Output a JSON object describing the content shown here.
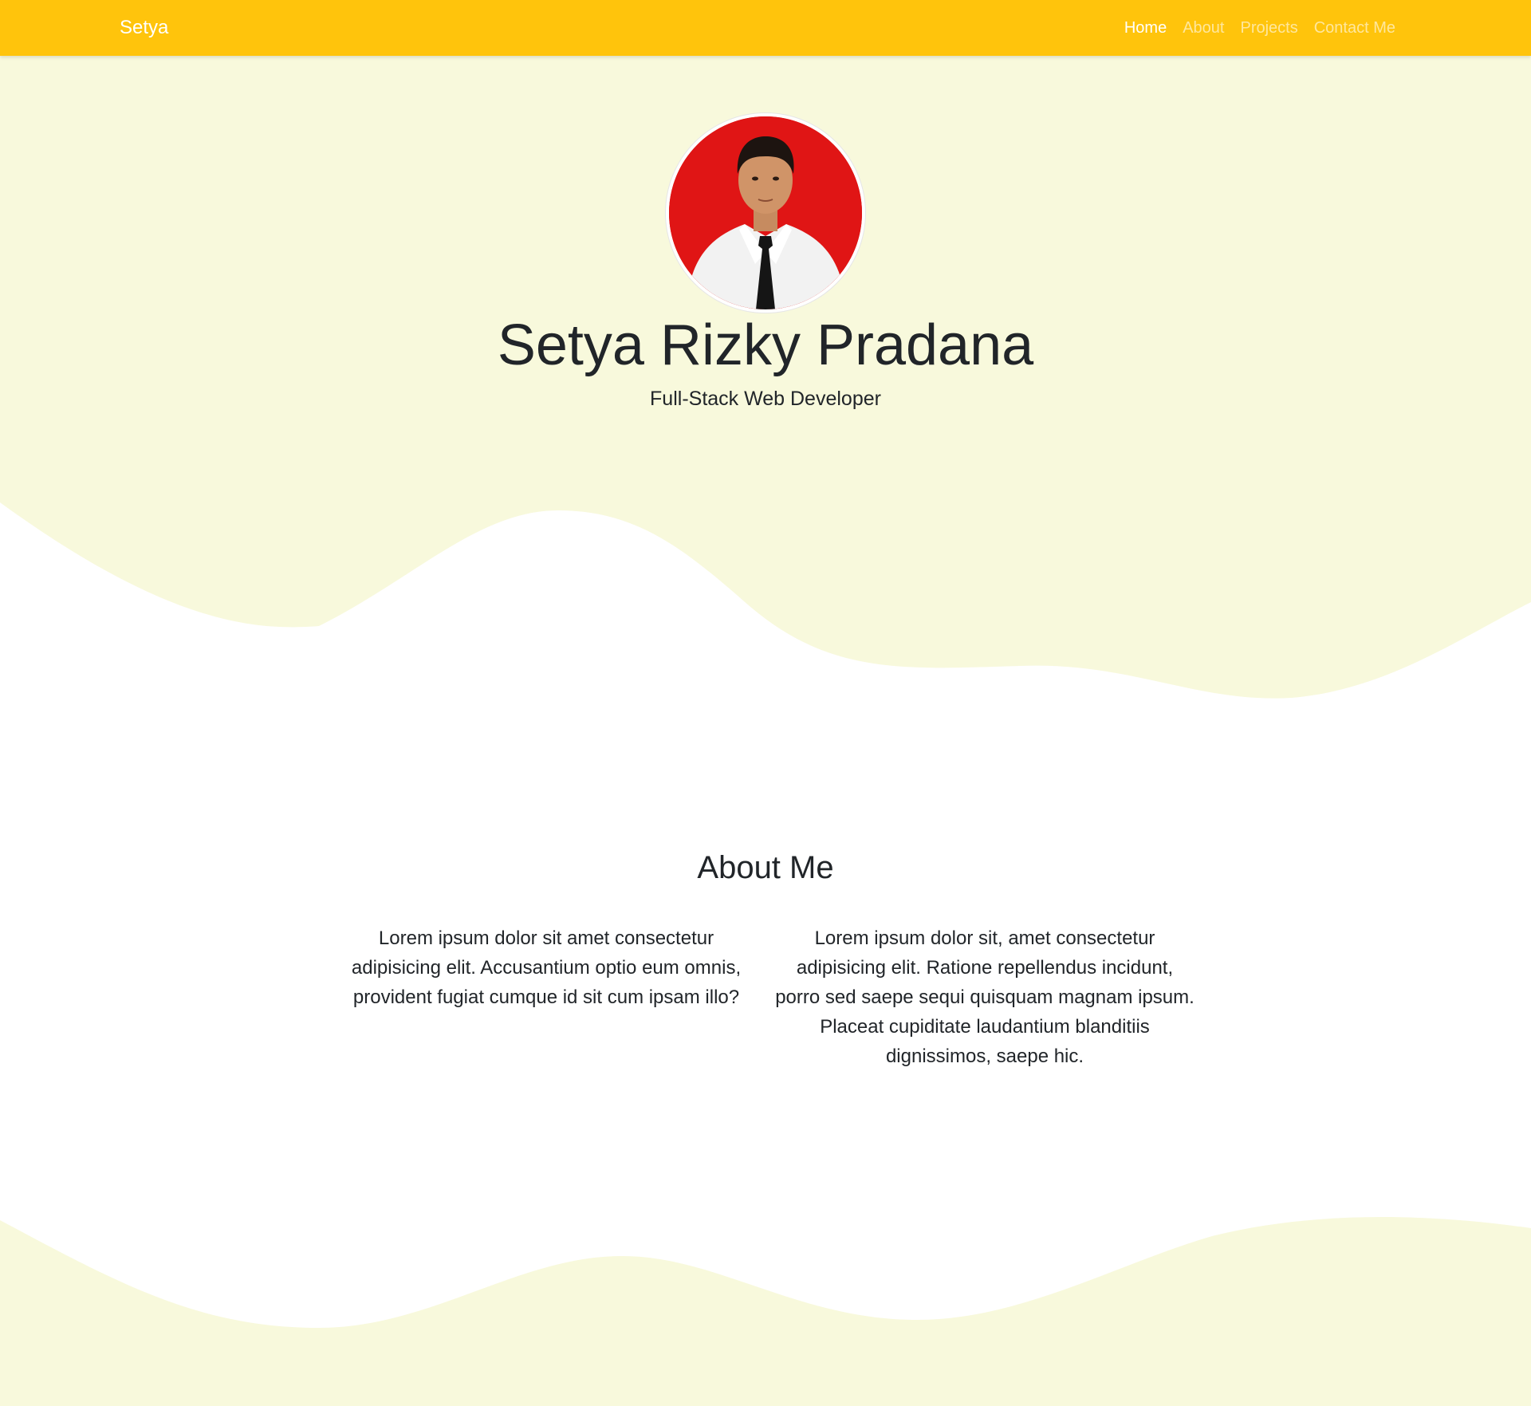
{
  "navbar": {
    "brand": "Setya",
    "links": [
      {
        "label": "Home",
        "active": true
      },
      {
        "label": "About",
        "active": false
      },
      {
        "label": "Projects",
        "active": false
      },
      {
        "label": "Contact Me",
        "active": false
      }
    ]
  },
  "hero": {
    "name": "Setya Rizky Pradana",
    "subtitle": "Full-Stack Web Developer"
  },
  "about": {
    "title": "About Me",
    "paragraphs": [
      "Lorem ipsum dolor sit amet consectetur adipisicing elit. Accusantium optio eum omnis, provident fugiat cumque id sit cum ipsam illo?",
      "Lorem ipsum dolor sit, amet consectetur adipisicing elit. Ratione repellendus incidunt, porro sed saepe sequi quisquam magnam ipsum. Placeat cupiditate laudantium blanditiis dignissimos, saepe hic."
    ]
  },
  "colors": {
    "navbar": "#ffc40c",
    "hero_background": "#f8f9dc",
    "text": "#212529",
    "avatar_background": "#e01515"
  }
}
